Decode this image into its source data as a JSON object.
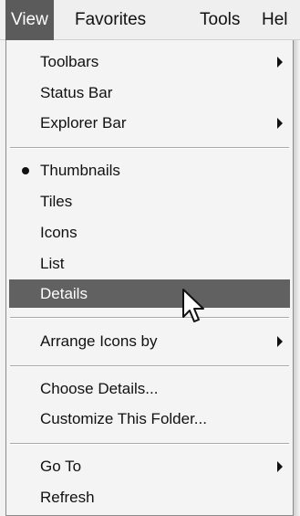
{
  "menubar": {
    "items": [
      {
        "label": "View"
      },
      {
        "label": "Favorites"
      },
      {
        "label": "Tools"
      },
      {
        "label": "Hel"
      }
    ]
  },
  "menu": {
    "items": [
      {
        "label": "Toolbars",
        "submenu": true
      },
      {
        "label": "Status Bar"
      },
      {
        "label": "Explorer Bar",
        "submenu": true
      },
      {
        "label": "Thumbnails",
        "checked": true
      },
      {
        "label": "Tiles"
      },
      {
        "label": "Icons"
      },
      {
        "label": "List"
      },
      {
        "label": "Details",
        "highlighted": true
      },
      {
        "label": "Arrange Icons by",
        "submenu": true
      },
      {
        "label": "Choose Details..."
      },
      {
        "label": "Customize This Folder..."
      },
      {
        "label": "Go To",
        "submenu": true
      },
      {
        "label": "Refresh"
      }
    ]
  },
  "colors": {
    "highlight": "#616161",
    "menu_background": "#f4f4f4"
  },
  "icons": [
    "submenu-arrow-icon",
    "radio-bullet-icon",
    "mouse-pointer-icon"
  ]
}
